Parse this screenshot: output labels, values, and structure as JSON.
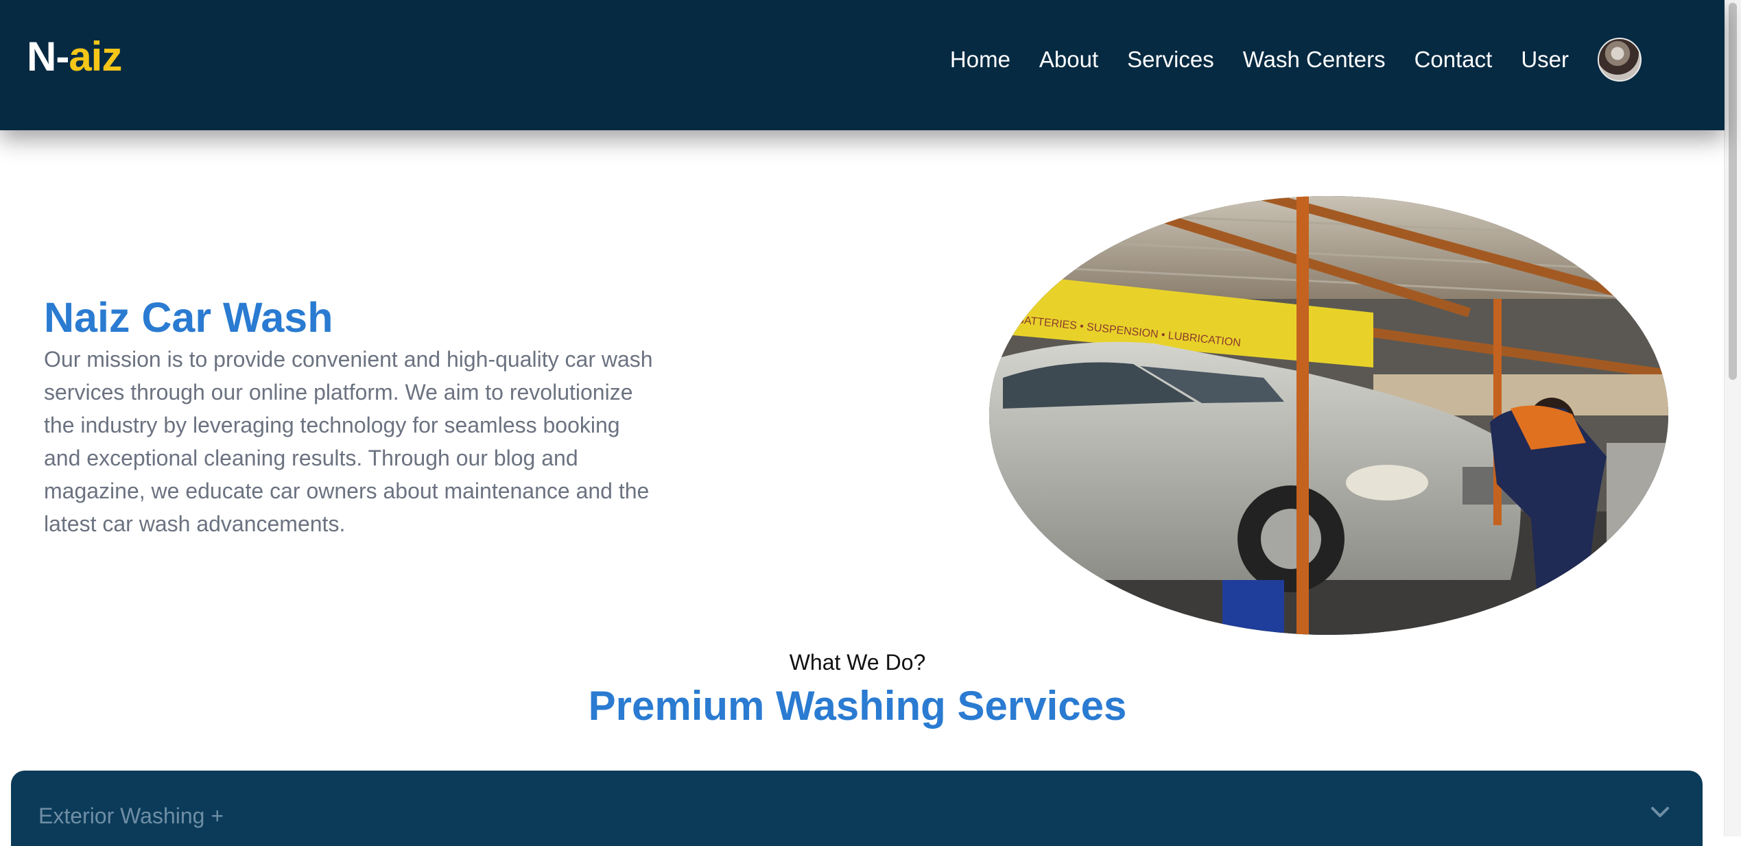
{
  "header": {
    "logo_part1": "N-",
    "logo_part2": "aiz",
    "nav": [
      "Home",
      "About",
      "Services",
      "Wash Centers",
      "Contact",
      "User"
    ]
  },
  "hero": {
    "title": "Naiz Car Wash",
    "text": "Our mission is to provide convenient and high-quality car wash services through our online platform. We aim to revolutionize the industry by leveraging technology for seamless booking and exceptional cleaning results. Through our blog and magazine, we educate car owners about maintenance and the latest car wash advancements.",
    "image_sign_text": "BATTERIES • SUSPENSION • LUBRICATION"
  },
  "services": {
    "subheading": "What We Do?",
    "title": "Premium Washing Services",
    "accordion_label": "Exterior Washing +"
  },
  "colors": {
    "navbar": "#062a42",
    "logo_accent": "#f5c518",
    "title_blue": "#2a7bd1",
    "accordion": "#0b3b59"
  }
}
